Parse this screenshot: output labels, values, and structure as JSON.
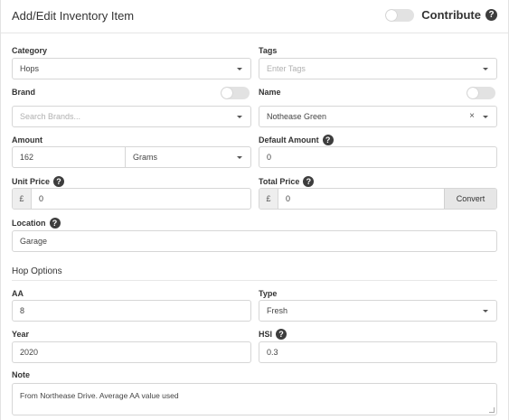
{
  "header": {
    "title": "Add/Edit Inventory Item",
    "contribute_label": "Contribute"
  },
  "form": {
    "category": {
      "label": "Category",
      "value": "Hops"
    },
    "tags": {
      "label": "Tags",
      "placeholder": "Enter Tags"
    },
    "brand": {
      "label": "Brand",
      "placeholder": "Search Brands..."
    },
    "name": {
      "label": "Name",
      "value": "Nothease Green"
    },
    "amount": {
      "label": "Amount",
      "value": "162",
      "unit": "Grams"
    },
    "default_amount": {
      "label": "Default Amount",
      "value": "0"
    },
    "unit_price": {
      "label": "Unit Price",
      "currency": "£",
      "value": "0"
    },
    "total_price": {
      "label": "Total Price",
      "currency": "£",
      "value": "0",
      "convert_label": "Convert"
    },
    "location": {
      "label": "Location",
      "value": "Garage"
    }
  },
  "hop_options": {
    "title": "Hop Options",
    "aa": {
      "label": "AA",
      "value": "8"
    },
    "type": {
      "label": "Type",
      "value": "Fresh"
    },
    "year": {
      "label": "Year",
      "value": "2020"
    },
    "hsi": {
      "label": "HSI",
      "value": "0.3"
    },
    "note": {
      "label": "Note",
      "value": "From Northease Drive.  Average AA value used"
    }
  },
  "icons": {
    "help": "?",
    "clear": "×"
  }
}
